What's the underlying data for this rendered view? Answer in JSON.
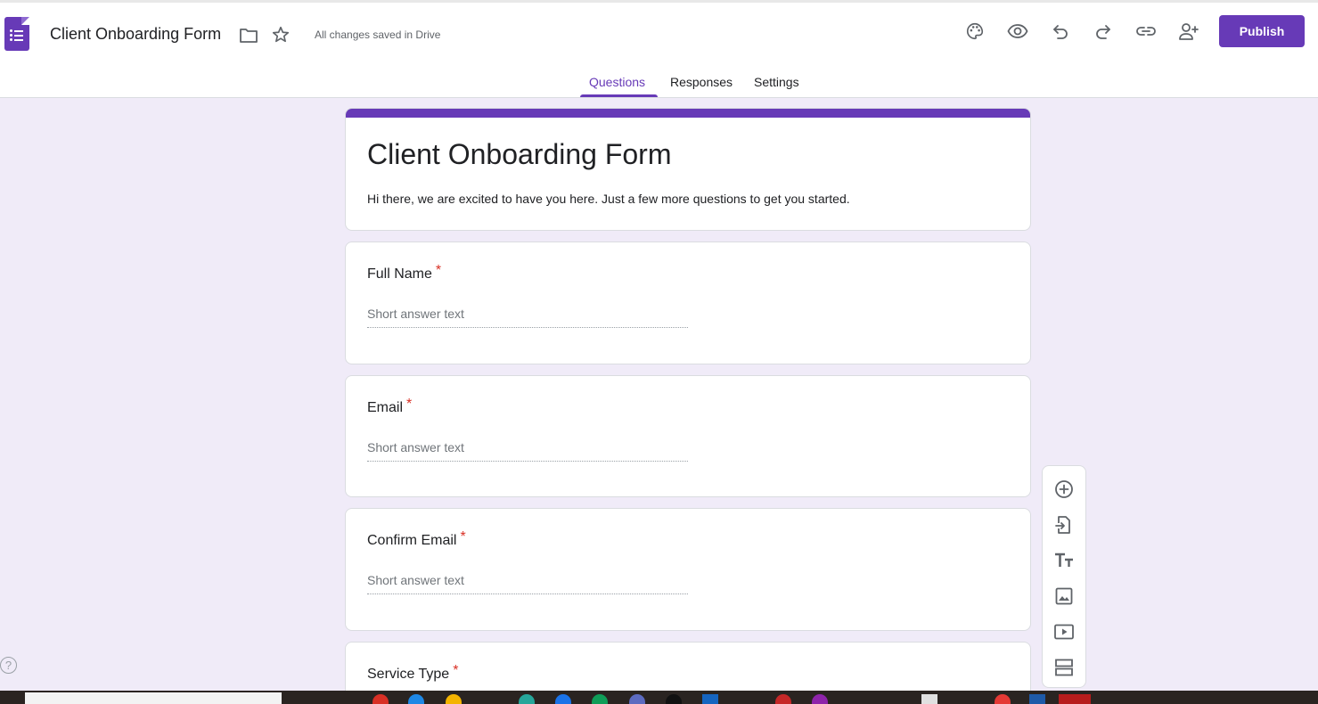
{
  "header": {
    "doc_title": "Client Onboarding Form",
    "save_status": "All changes saved in Drive",
    "publish_label": "Publish",
    "icons": [
      "forms-app-icon",
      "folder-icon",
      "star-icon",
      "palette-icon",
      "preview-eye-icon",
      "undo-icon",
      "redo-icon",
      "link-icon",
      "add-collaborator-icon"
    ]
  },
  "tabs": [
    {
      "label": "Questions",
      "active": true
    },
    {
      "label": "Responses",
      "active": false
    },
    {
      "label": "Settings",
      "active": false
    }
  ],
  "form": {
    "title": "Client Onboarding Form",
    "description": "Hi there, we are excited to have you here. Just a few more questions to get you started."
  },
  "questions": [
    {
      "title": "Full Name",
      "required_mark": "*",
      "placeholder": "Short answer text"
    },
    {
      "title": "Email",
      "required_mark": "*",
      "placeholder": "Short answer text"
    },
    {
      "title": "Confirm Email",
      "required_mark": "*",
      "placeholder": "Short answer text"
    },
    {
      "title": "Service Type",
      "required_mark": "*"
    }
  ],
  "side_toolbar": [
    "add-question-icon",
    "import-questions-icon",
    "add-title-icon",
    "add-image-icon",
    "add-video-icon",
    "add-section-icon"
  ],
  "help_glyph": "?",
  "colors": {
    "accent": "#673ab7",
    "background": "#f0ebf8",
    "required": "#d93025"
  }
}
